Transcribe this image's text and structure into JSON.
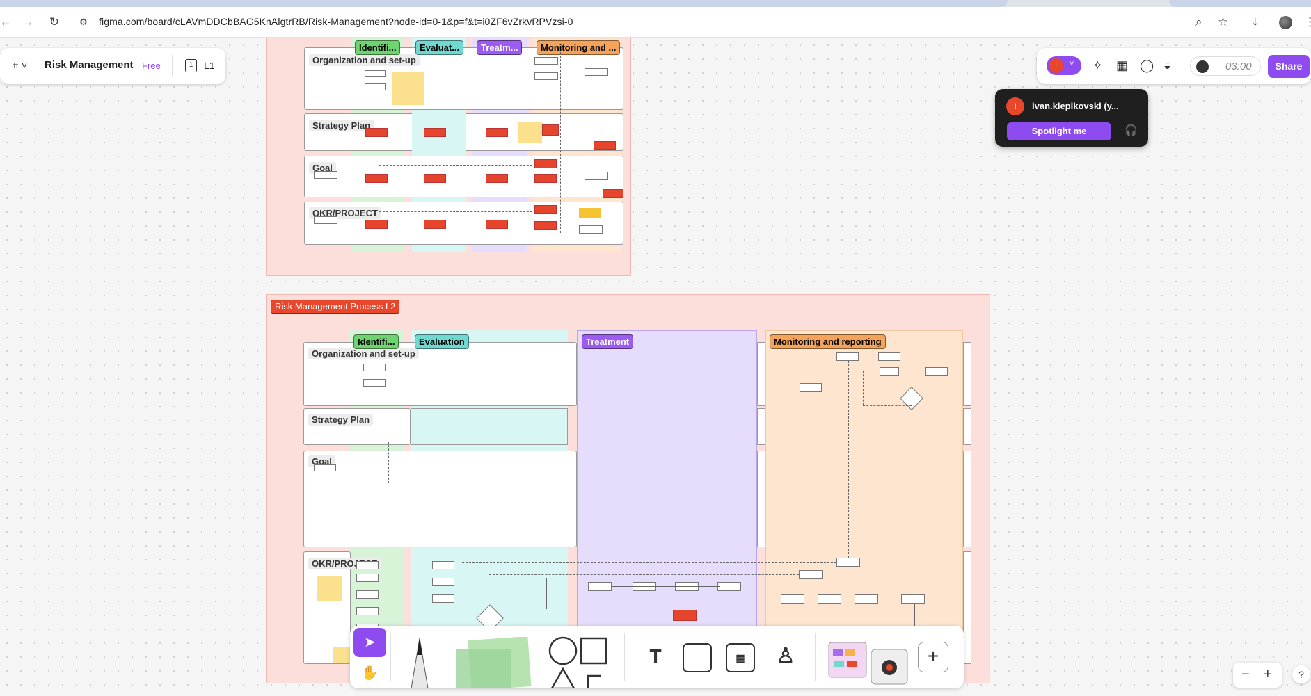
{
  "browser": {
    "url": "figma.com/board/cLAVmDDCbBAG5KnAlgtrRB/Risk-Management?node-id=0-1&p=f&t=i0ZF6vZrkvRPVzsi-0",
    "back_icon": "arrow-left-icon",
    "forward_icon": "arrow-right-icon",
    "reload_icon": "reload-icon"
  },
  "file": {
    "name": "Risk Management",
    "plan": "Free",
    "page": "L1",
    "page_icon_text": "1"
  },
  "toolbar_right": {
    "user_initial": "I",
    "timer": "03:00",
    "share_label": "Share"
  },
  "spotlight": {
    "initial": "I",
    "user_name": "ivan.klepikovski (y...",
    "button_label": "Spotlight me"
  },
  "board": {
    "section1": {
      "tags": [
        "Identifi...",
        "Evaluat...",
        "Treatm...",
        "Monitoring and ..."
      ],
      "lanes": [
        "Organization and set-up",
        "Strategy Plan",
        "Goal",
        "OKR/PROJECT"
      ]
    },
    "section2": {
      "title": "Risk Management Process L2",
      "tags": [
        "Identifi...",
        "Evaluation",
        "Treatment",
        "Monitoring and reporting"
      ],
      "lanes": [
        "Organization and set-up",
        "Strategy Plan",
        "Goal",
        "OKR/PROJECT"
      ]
    }
  },
  "colors": {
    "accent": "#8d4bf0",
    "section_bg": "#fcdedb",
    "identify": "#6fd36f",
    "evaluate": "#6fd8d0",
    "treatment": "#9d5cf0",
    "monitoring": "#f4a45a"
  },
  "bottom_toolbar": {
    "tools": [
      "select",
      "hand",
      "pen",
      "sticky-note",
      "shapes",
      "text",
      "section",
      "table",
      "stamp",
      "templates",
      "more"
    ],
    "text_tool_glyph": "T",
    "plus_glyph": "+"
  },
  "zoom": {
    "minus": "−",
    "plus": "+",
    "help": "?"
  }
}
